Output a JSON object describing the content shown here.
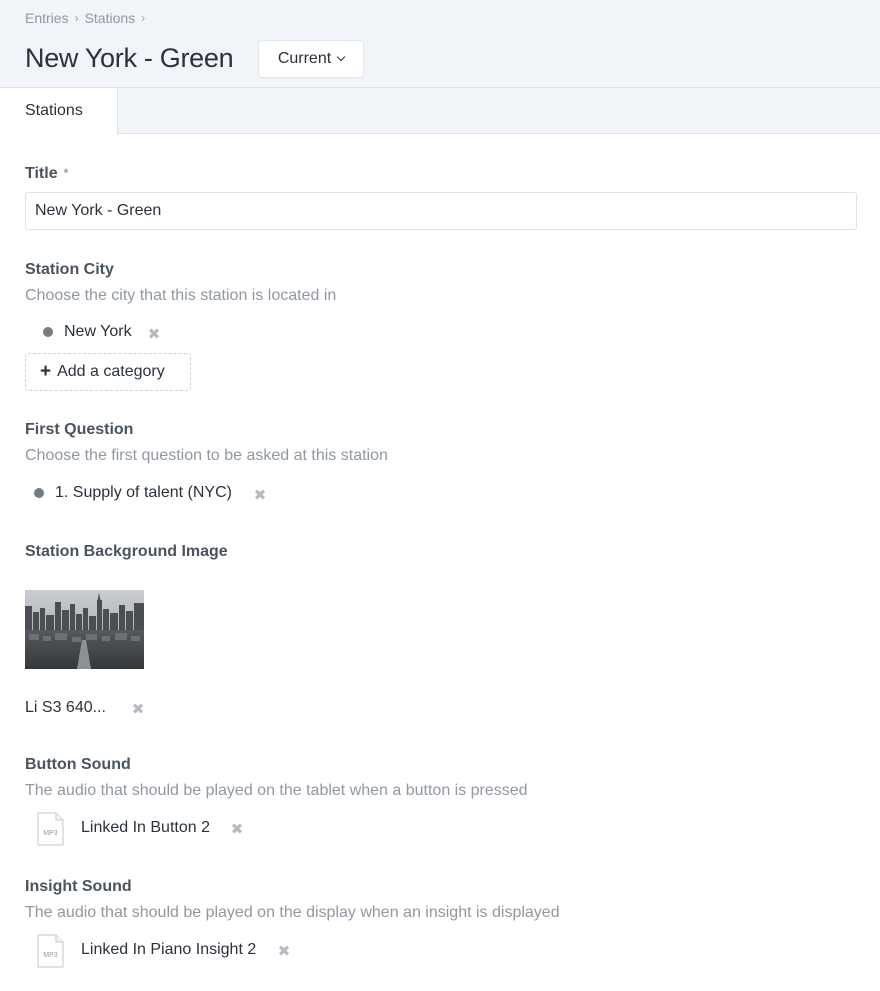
{
  "breadcrumb": [
    "Entries",
    "Stations"
  ],
  "title": "New York - Green",
  "revision_label": "Current",
  "tabs": [
    {
      "label": "Stations"
    }
  ],
  "fields": {
    "title": {
      "label": "Title",
      "required_mark": "*",
      "value": "New York - Green"
    },
    "station_city": {
      "label": "Station City",
      "instructions": "Choose the city that this station is located in",
      "selected": "New York",
      "add_label": "Add a category"
    },
    "first_question": {
      "label": "First Question",
      "instructions": "Choose the first question to be asked at this station",
      "selected": "1. Supply of talent (NYC)"
    },
    "background_image": {
      "label": "Station Background Image",
      "file_name": "Li S3 640..."
    },
    "button_sound": {
      "label": "Button Sound",
      "instructions": "The audio that should be played on the tablet when a button is pressed",
      "file_ext": "MP3",
      "file_name": "Linked In Button 2"
    },
    "insight_sound": {
      "label": "Insight Sound",
      "instructions": "The audio that should be played on the display when an insight is displayed",
      "file_ext": "MP3",
      "file_name": "Linked In Piano Insight 2"
    }
  },
  "icons": {
    "remove": "remove-icon",
    "add": "plus-icon",
    "status": "status-dot",
    "chevron": "chevron-down-icon",
    "file": "file-icon"
  },
  "colors": {
    "header_bg": "#f1f4f8",
    "text": "#29323d",
    "muted": "#8f98a3",
    "status_dot": "#737b85"
  }
}
